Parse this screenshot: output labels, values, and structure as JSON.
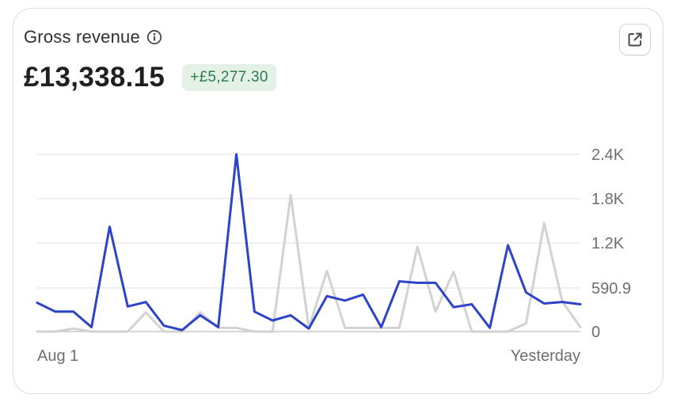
{
  "header": {
    "title": "Gross revenue",
    "info_icon": "info-icon",
    "external_icon": "external-link-icon"
  },
  "summary": {
    "value": "£13,338.15",
    "delta": "+£5,277.30"
  },
  "colors": {
    "current_series": "#2d44c8",
    "comparison_series": "#d2d2d2",
    "delta_text": "#2e7d4f",
    "delta_bg": "#e3f1e6"
  },
  "chart_data": {
    "type": "line",
    "x_labels": [
      "Aug 1",
      "Yesterday"
    ],
    "y_ticks": [
      "2.4K",
      "1.8K",
      "1.2K",
      "590.9",
      "0"
    ],
    "ylim": [
      0,
      2400
    ],
    "grid": true,
    "series": [
      {
        "values": [
          390,
          270,
          270,
          60,
          1420,
          340,
          400,
          80,
          20,
          220,
          60,
          2400,
          270,
          150,
          220,
          40,
          480,
          420,
          500,
          60,
          680,
          660,
          660,
          330,
          370,
          50,
          1170,
          530,
          380,
          400,
          370
        ]
      },
      {
        "values": [
          0,
          0,
          40,
          0,
          0,
          0,
          260,
          0,
          0,
          260,
          50,
          50,
          0,
          0,
          1850,
          50,
          820,
          50,
          50,
          50,
          50,
          1150,
          270,
          810,
          0,
          0,
          0,
          110,
          1470,
          410,
          60
        ]
      }
    ]
  }
}
